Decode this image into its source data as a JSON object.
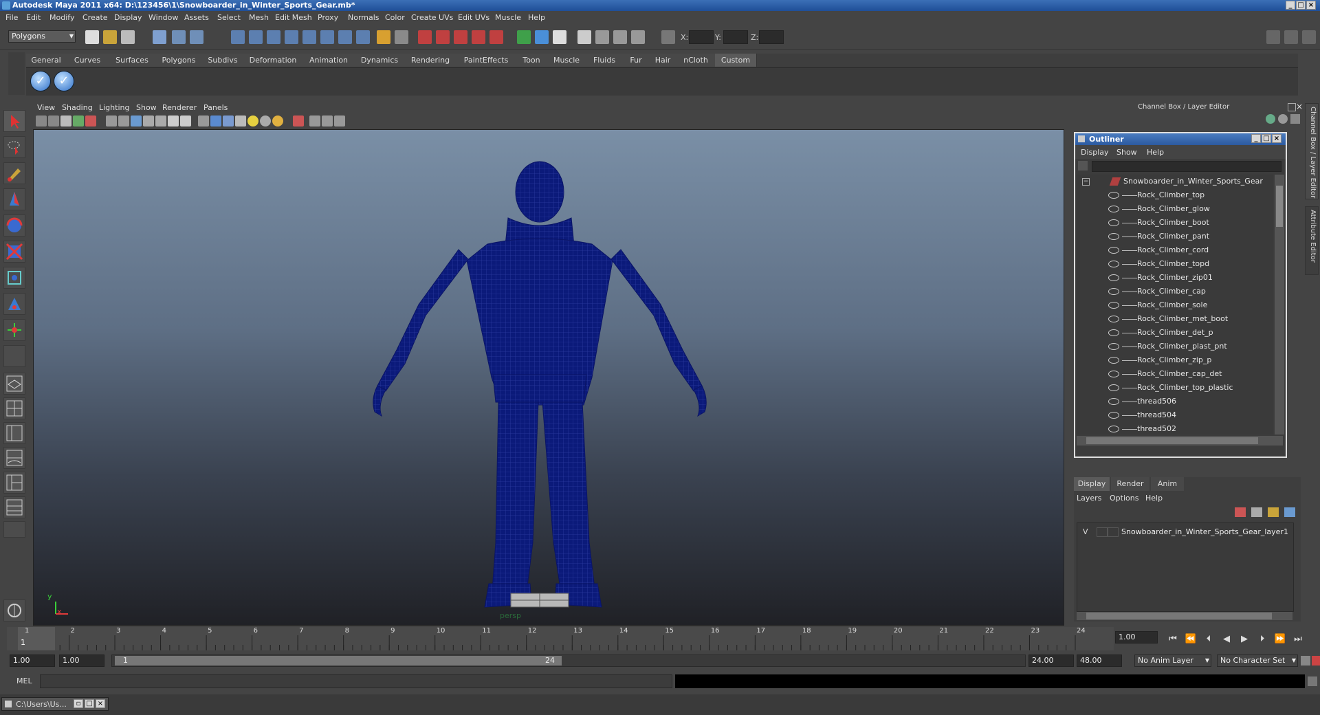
{
  "window": {
    "title": "Autodesk Maya 2011 x64: D:\\123456\\1\\Snowboarder_in_Winter_Sports_Gear.mb*"
  },
  "menubar": [
    "File",
    "Edit",
    "Modify",
    "Create",
    "Display",
    "Window",
    "Assets",
    "Select",
    "Mesh",
    "Edit Mesh",
    "Proxy",
    "Normals",
    "Color",
    "Create UVs",
    "Edit UVs",
    "Muscle",
    "Help"
  ],
  "status_line": {
    "mode": "Polygons",
    "x_label": "X:",
    "y_label": "Y:",
    "z_label": "Z:"
  },
  "shelf": {
    "tabs": [
      "General",
      "Curves",
      "Surfaces",
      "Polygons",
      "Subdivs",
      "Deformation",
      "Animation",
      "Dynamics",
      "Rendering",
      "PaintEffects",
      "Toon",
      "Muscle",
      "Fluids",
      "Fur",
      "Hair",
      "nCloth",
      "Custom"
    ],
    "active_tab": "Custom"
  },
  "viewport": {
    "menu": [
      "View",
      "Shading",
      "Lighting",
      "Show",
      "Renderer",
      "Panels"
    ],
    "camera_label": "persp",
    "axis_y": "y",
    "axis_x": "x",
    "wire_color": "#0b1a7a"
  },
  "right_panel": {
    "header": "Channel Box / Layer Editor",
    "side_tabs": [
      "Channel Box / Layer Editor",
      "Attribute Editor"
    ]
  },
  "outliner": {
    "title": "Outliner",
    "menu": [
      "Display",
      "Show",
      "Help"
    ],
    "root": "Snowboarder_in_Winter_Sports_Gear",
    "items": [
      "Rock_Climber_top",
      "Rock_Climber_glow",
      "Rock_Climber_boot",
      "Rock_Climber_pant",
      "Rock_Climber_cord",
      "Rock_Climber_topd",
      "Rock_Climber_zip01",
      "Rock_Climber_cap",
      "Rock_Climber_sole",
      "Rock_Climber_met_boot",
      "Rock_Climber_det_p",
      "Rock_Climber_plast_pnt",
      "Rock_Climber_zip_p",
      "Rock_Climber_cap_det",
      "Rock_Climber_top_plastic",
      "thread506",
      "thread504",
      "thread502"
    ]
  },
  "layer_editor": {
    "tabs": [
      "Display",
      "Render",
      "Anim"
    ],
    "active_tab": "Display",
    "menu": [
      "Layers",
      "Options",
      "Help"
    ],
    "layer_visibility": "V",
    "layer_name": "Snowboarder_in_Winter_Sports_Gear_layer1"
  },
  "timeline": {
    "ticks": [
      "1",
      "2",
      "3",
      "4",
      "5",
      "6",
      "7",
      "8",
      "9",
      "10",
      "11",
      "12",
      "13",
      "14",
      "15",
      "16",
      "17",
      "18",
      "19",
      "20",
      "21",
      "22",
      "23",
      "24"
    ],
    "current_frame": "1",
    "current_time_field": "1.00"
  },
  "range": {
    "start_time": "1.00",
    "playback_start": "1.00",
    "slider_start": "1",
    "slider_end": "24",
    "playback_end": "24.00",
    "end_time": "48.00",
    "anim_layer": "No Anim Layer",
    "character_set": "No Character Set"
  },
  "command_line": {
    "label": "MEL"
  },
  "taskbar": {
    "item": "C:\\Users\\Us..."
  }
}
